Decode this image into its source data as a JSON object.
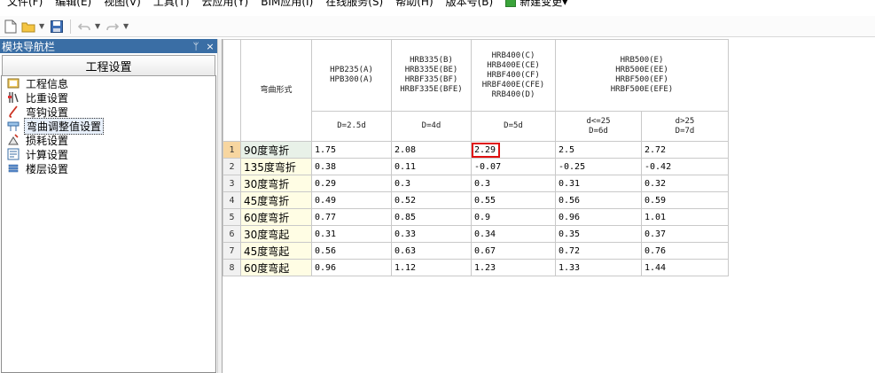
{
  "menu": {
    "items": [
      "文件(F)",
      "编辑(E)",
      "视图(V)",
      "工具(T)",
      "云应用(Y)",
      "BIM应用(I)",
      "在线服务(S)",
      "帮助(H)",
      "版本号(B)"
    ],
    "new_change": "新建变更"
  },
  "toolbar": {
    "icons": [
      "new-file-icon",
      "open-folder-icon",
      "save-icon",
      "undo-icon",
      "redo-icon"
    ]
  },
  "nav": {
    "title": "模块导航栏",
    "pin_glyph": "ᛘ",
    "close_glyph": "×",
    "section": "工程设置",
    "items": [
      {
        "label": "工程信息",
        "icon": "project-info-icon"
      },
      {
        "label": "比重设置",
        "icon": "weight-icon"
      },
      {
        "label": "弯钩设置",
        "icon": "hook-icon"
      },
      {
        "label": "弯曲调整值设置",
        "icon": "bend-adjust-icon"
      },
      {
        "label": "损耗设置",
        "icon": "loss-icon"
      },
      {
        "label": "计算设置",
        "icon": "calc-icon"
      },
      {
        "label": "楼层设置",
        "icon": "floor-icon"
      }
    ],
    "selected_index": 3
  },
  "grid": {
    "bend_header": "弯曲形式",
    "groups": [
      {
        "lines": [
          "HPB235(A)",
          "HPB300(A)"
        ],
        "span": 1
      },
      {
        "lines": [
          "HRB335(B)",
          "HRB335E(BE)",
          "HRBF335(BF)",
          "HRBF335E(BFE)"
        ],
        "span": 1
      },
      {
        "lines": [
          "HRB400(C)",
          "HRB400E(CE)",
          "HRBF400(CF)",
          "HRBF400E(CFE)",
          "RRB400(D)"
        ],
        "span": 1
      },
      {
        "lines": [
          "HRB500(E)",
          "HRB500E(EE)",
          "HRBF500(EF)",
          "HRBF500E(EFE)"
        ],
        "span": 2
      }
    ],
    "subheaders": [
      [
        "D=2.5d"
      ],
      [
        "D=4d"
      ],
      [
        "D=5d"
      ],
      [
        "d<=25",
        "D=6d"
      ],
      [
        "d>25",
        "D=7d"
      ]
    ],
    "rows": [
      {
        "no": "1",
        "name": "90度弯折",
        "values": [
          "1.75",
          "2.08",
          "2.29",
          "2.5",
          "2.72"
        ]
      },
      {
        "no": "2",
        "name": "135度弯折",
        "values": [
          "0.38",
          "0.11",
          "-0.07",
          "-0.25",
          "-0.42"
        ]
      },
      {
        "no": "3",
        "name": "30度弯折",
        "values": [
          "0.29",
          "0.3",
          "0.3",
          "0.31",
          "0.32"
        ]
      },
      {
        "no": "4",
        "name": "45度弯折",
        "values": [
          "0.49",
          "0.52",
          "0.55",
          "0.56",
          "0.59"
        ]
      },
      {
        "no": "5",
        "name": "60度弯折",
        "values": [
          "0.77",
          "0.85",
          "0.9",
          "0.96",
          "1.01"
        ]
      },
      {
        "no": "6",
        "name": "30度弯起",
        "values": [
          "0.31",
          "0.33",
          "0.34",
          "0.35",
          "0.37"
        ]
      },
      {
        "no": "7",
        "name": "45度弯起",
        "values": [
          "0.56",
          "0.63",
          "0.67",
          "0.72",
          "0.76"
        ]
      },
      {
        "no": "8",
        "name": "60度弯起",
        "values": [
          "0.96",
          "1.12",
          "1.23",
          "1.33",
          "1.44"
        ]
      }
    ],
    "highlight": {
      "row": 0,
      "col": 2
    },
    "colors": {
      "bend_header_text": "#b03a1a",
      "highlight_border": "#e01010",
      "nav_title_bg": "#3a6ea5"
    }
  }
}
